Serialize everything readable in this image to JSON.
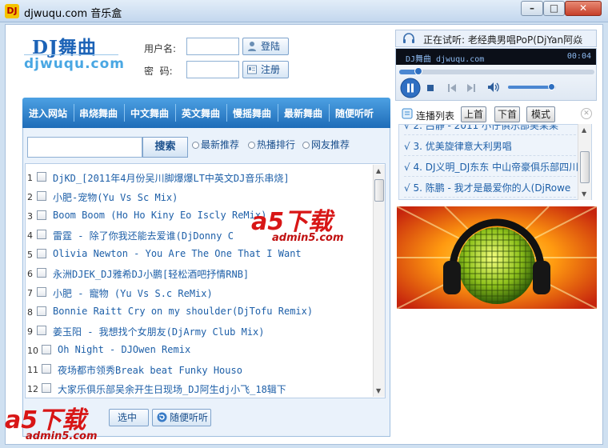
{
  "window": {
    "title": "djwuqu.com 音乐盒",
    "icon_text": "DJ",
    "min_icon": "minimize-icon",
    "max_icon": "maximize-icon",
    "close_icon": "close-icon"
  },
  "logo": {
    "line1": "DJ舞曲",
    "line2": "djwuqu.com"
  },
  "login": {
    "username_label": "用户名:",
    "password_label": "密  码:",
    "username_value": "",
    "password_value": "",
    "login_button": "登陆",
    "register_button": "注册"
  },
  "nav": {
    "items": [
      "进入网站",
      "串烧舞曲",
      "中文舞曲",
      "英文舞曲",
      "慢摇舞曲",
      "最新舞曲",
      "随便听听"
    ]
  },
  "search": {
    "value": "",
    "button": "搜索",
    "tabs": [
      "最新推荐",
      "热播排行",
      "网友推荐"
    ]
  },
  "songs": [
    {
      "num": "1",
      "title": "DjKD_[2011年4月份吴川脚爆爆LT中英文DJ音乐串烧]"
    },
    {
      "num": "2",
      "title": "小肥-宠物(Yu Vs Sc Mix)"
    },
    {
      "num": "3",
      "title": "Boom Boom (Ho Ho Kiny Eo Iscly ReMix)"
    },
    {
      "num": "4",
      "title": "雷霆 - 除了你我还能去爱谁(DjDonny C"
    },
    {
      "num": "5",
      "title": "Olivia Newton - You Are The One That I Want"
    },
    {
      "num": "6",
      "title": "永洲DJEK_DJ雅希DJ小鹏[轻松酒吧抒情RNB]"
    },
    {
      "num": "7",
      "title": "小肥 - 寵物 (Yu Vs S.c ReMix)"
    },
    {
      "num": "8",
      "title": "Bonnie Raitt Cry on my shoulder(DjTofu Remix)"
    },
    {
      "num": "9",
      "title": "姜玉阳 - 我想找个女朋友(DjArmy Club Mix)"
    },
    {
      "num": "10",
      "title": "Oh Night - DJOwen Remix"
    },
    {
      "num": "11",
      "title": "夜场都市领秀Break beat Funky Houso"
    },
    {
      "num": "12",
      "title": "大家乐俱乐部吴余开生日现场_DJ阿生dj小飞_18辑下"
    }
  ],
  "bottom": {
    "play_selected": "选中",
    "random_listen": "随便听听"
  },
  "player": {
    "now_playing": "正在试听: 老经典男唱PoP(DjYan阿焱",
    "screen_left": "DJ舞曲 djwuqu.com",
    "screen_time": "00:04",
    "progress": 0.1,
    "volume": 0.9
  },
  "playlist": {
    "title": "连播列表",
    "buttons": [
      "上首",
      "下首",
      "模式"
    ],
    "items": [
      "√ 2. 吕静 - 2011 小仔俱乐部吴某某",
      "√ 3. 优美旋律意大利男唱",
      "√ 4. DJ义明_DJ东东  中山帝豪俱乐部四川",
      "√ 5. 陈鹏 - 我才是最爱你的人(DjRowe"
    ]
  },
  "watermark": {
    "brand": "a5下载",
    "domain": "admin5.com"
  }
}
